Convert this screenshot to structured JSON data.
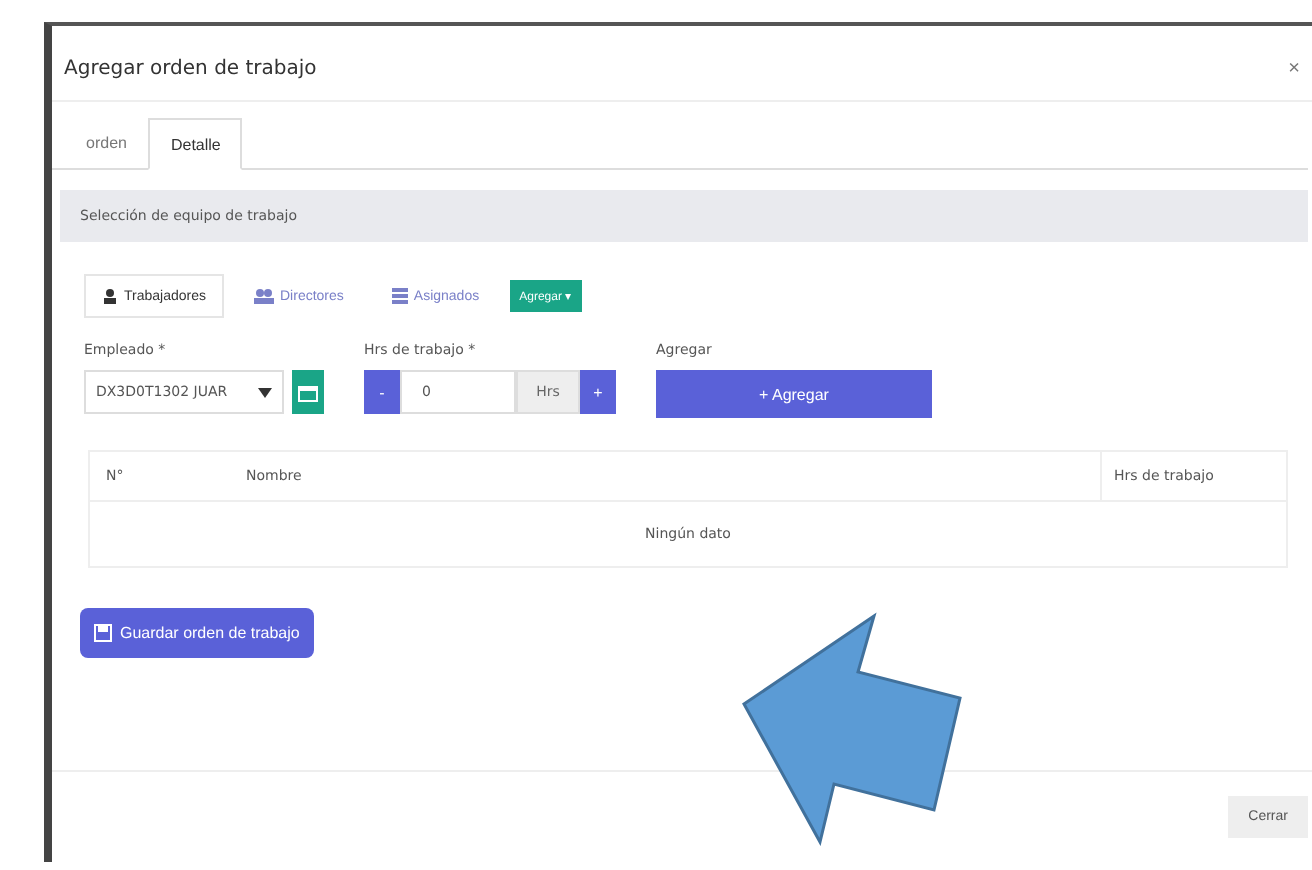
{
  "dialog": {
    "title": "Agregar orden de trabajo",
    "close": "×"
  },
  "tabs": [
    {
      "label": "orden",
      "selected": false
    },
    {
      "label": "Detalle",
      "selected": true
    }
  ],
  "section_title": "Selección de equipo de trabajo",
  "subtabs": [
    {
      "label": "Trabajadores",
      "kind": "user",
      "selected": true
    },
    {
      "label": "Directores",
      "kind": "group",
      "selected": false
    },
    {
      "label": "Asignados",
      "kind": "list",
      "selected": false
    }
  ],
  "add_dropdown": "Agregar ▾",
  "form": {
    "employee_label": "Empleado *",
    "employee_value": "DX3D0T1302 JUAR",
    "hours_label": "Hrs de trabajo *",
    "minus": "-",
    "hours_value": "0",
    "hours_unit": "Hrs",
    "plus": "+",
    "add_label": "Agregar",
    "add_button": "+ Agregar"
  },
  "table": {
    "columns": [
      "N°",
      "Nombre",
      "Hrs de trabajo"
    ],
    "empty": "Ningún dato"
  },
  "save_button": "Guardar orden de trabajo",
  "close_button": "Cerrar"
}
